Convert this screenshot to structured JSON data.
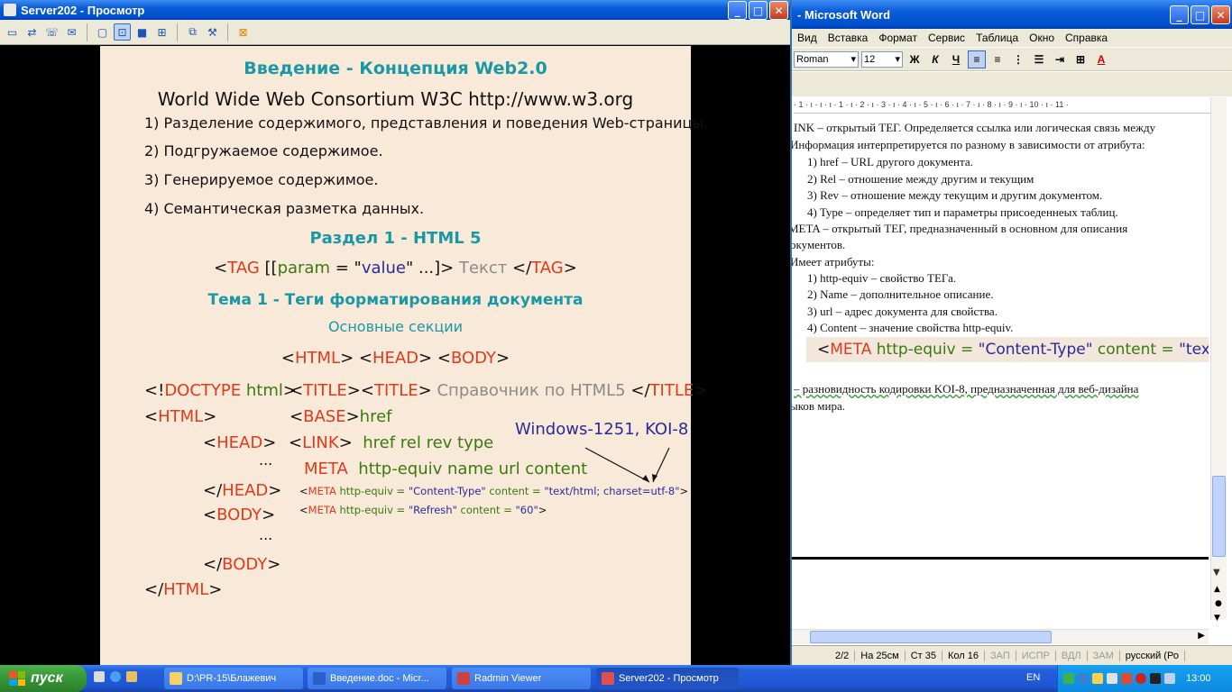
{
  "radmin": {
    "title": "Server202 - Просмотр",
    "toolbar_icons": [
      "monitor-icon",
      "remote-control-icon",
      "phone-icon",
      "chat-icon",
      "view-normal-icon",
      "view-fit-icon",
      "fullscreen-icon",
      "grid-icon",
      "copy-icon",
      "settings-icon",
      "close-connection-icon"
    ]
  },
  "slide": {
    "title": "Введение - Концепция Web2.0",
    "consortium": "World Wide Web Consortium   W3C   http://www.w3.org",
    "items": [
      "1) Разделение содержимого, представления и поведения Web-страницы.",
      "2) Подгружаемое содержимое.",
      "3) Генерируемое содержимое.",
      "4) Семантическая разметка данных."
    ],
    "section": "Раздел 1 - HTML 5",
    "tag_syntax": {
      "lt": "<",
      "tag": "TAG",
      "open": " [[",
      "param": "param",
      "eq": " = \"",
      "value": "value",
      "rest": "\" ...]> ",
      "text": "Текст",
      "close": " </",
      "tag2": "TAG",
      "end": ">"
    },
    "topic": "Тема 1 - Теги форматирования документа",
    "subtitle": "Основные секции",
    "sections_line": {
      "a": "<",
      "html": "HTML",
      "b": "> <",
      "head": "HEAD",
      "c": "> <",
      "body": "BODY",
      "d": ">"
    },
    "doctype": {
      "a": "<!",
      "doctype": "DOCTYPE",
      "b": " html",
      "c": ">"
    },
    "title_line": {
      "a": "<",
      "t1": "TITLE",
      "b": "><",
      "t2": "TITLE",
      "c": "> ",
      "text": "Справочник по HTML5",
      "d": " </",
      "t3": "TITLE",
      "e": ">"
    },
    "html_open": {
      "a": "<",
      "tag": "HTML",
      "b": ">"
    },
    "base_line": {
      "a": "<",
      "tag": "BASE",
      "b": ">",
      "attr": "href"
    },
    "head_open": {
      "a": "<",
      "tag": "HEAD",
      "b": ">"
    },
    "link_line": {
      "a": "<",
      "tag": "LINK",
      "b": ">",
      "attrs": "href  rel  rev  type"
    },
    "encoding_note": "Windows-1251, KOI-8",
    "dots1": "...",
    "meta_line": {
      "tag": "META",
      "attrs": "http-equiv  name  url  content"
    },
    "meta_ex1": {
      "a": "<",
      "tag": "META",
      "attr": " http-equiv = ",
      "val1": "\"Content-Type\"",
      "c": " content = ",
      "val2": "\"text/html; charset=utf-8\"",
      "d": ">"
    },
    "meta_ex2": {
      "a": "<",
      "tag": "META",
      "attr": " http-equiv = ",
      "val1": "\"Refresh\"",
      "c": " content = ",
      "val2": "\"60\"",
      "d": ">"
    },
    "head_close": {
      "a": "</",
      "tag": "HEAD",
      "b": ">"
    },
    "body_open": {
      "a": "<",
      "tag": "BODY",
      "b": ">"
    },
    "dots2": "...",
    "body_close": {
      "a": "</",
      "tag": "BODY",
      "b": ">"
    },
    "html_close": {
      "a": "</",
      "tag": "HTML",
      "b": ">"
    }
  },
  "word": {
    "title": "- Microsoft Word",
    "menu": [
      "Вид",
      "Вставка",
      "Формат",
      "Сервис",
      "Таблица",
      "Окно",
      "Справка"
    ],
    "font": "Roman",
    "size": "12",
    "bold": "Ж",
    "italic": "К",
    "underline": "Ч",
    "ruler": "· 1 · ı · ı · ı · 1 · ı · 2 · ı · 3 · ı · 4 · ı · 5 · ı · 6 · ı · 7 · ı · 8 · ı · 9 · ı · 10 · ı · 11 ·",
    "doc_lines": [
      "INK – открытый ТЕГ. Определяется ссылка или логическая связь между",
      "Информация интерпретируется по разному в зависимости от атрибута:",
      "1)   href – URL другого документа.",
      "2)   Rel – отношение между другим и текущим",
      "3)   Rev – отношение между текущим и другим документом.",
      "4)   Type – определяет тип и параметры присоеденнеых таблиц.",
      "META – открытый ТЕГ, предназначенный в основном для описания",
      "окументов.",
      "Имеет атрибуты:",
      "1)   http-equiv – свойство ТЕГа.",
      "2)   Name – дополнительное описание.",
      "3)   url – адрес документа для свойства.",
      "4)   Content – значение свойства http-equiv."
    ],
    "meta_snippet": {
      "a": "<",
      "tag": "META",
      "attr": " http-equiv = ",
      "val": "\"Content-Type\"",
      "c": " content = ",
      "d": "\"tex"
    },
    "koi_line1": "– разновидность кодировки KOI-8, предназначенная для веб-дизайна",
    "koi_line2": "ыков мира.",
    "status": {
      "page": "2/2",
      "at": "На 25см",
      "line": "Ст 35",
      "col": "Кол 16",
      "rec": "ЗАП",
      "trk": "ИСПР",
      "ext": "ВДЛ",
      "ovr": "ЗАМ",
      "lang": "русский (Ро"
    }
  },
  "taskbar": {
    "start": "пуск",
    "buttons": [
      "D:\\PR-15\\Блажевич",
      "Введение.doc - Micr...",
      "Radmin Viewer",
      "Server202 - Просмотр"
    ],
    "lang": "EN",
    "clock": "13:00"
  }
}
